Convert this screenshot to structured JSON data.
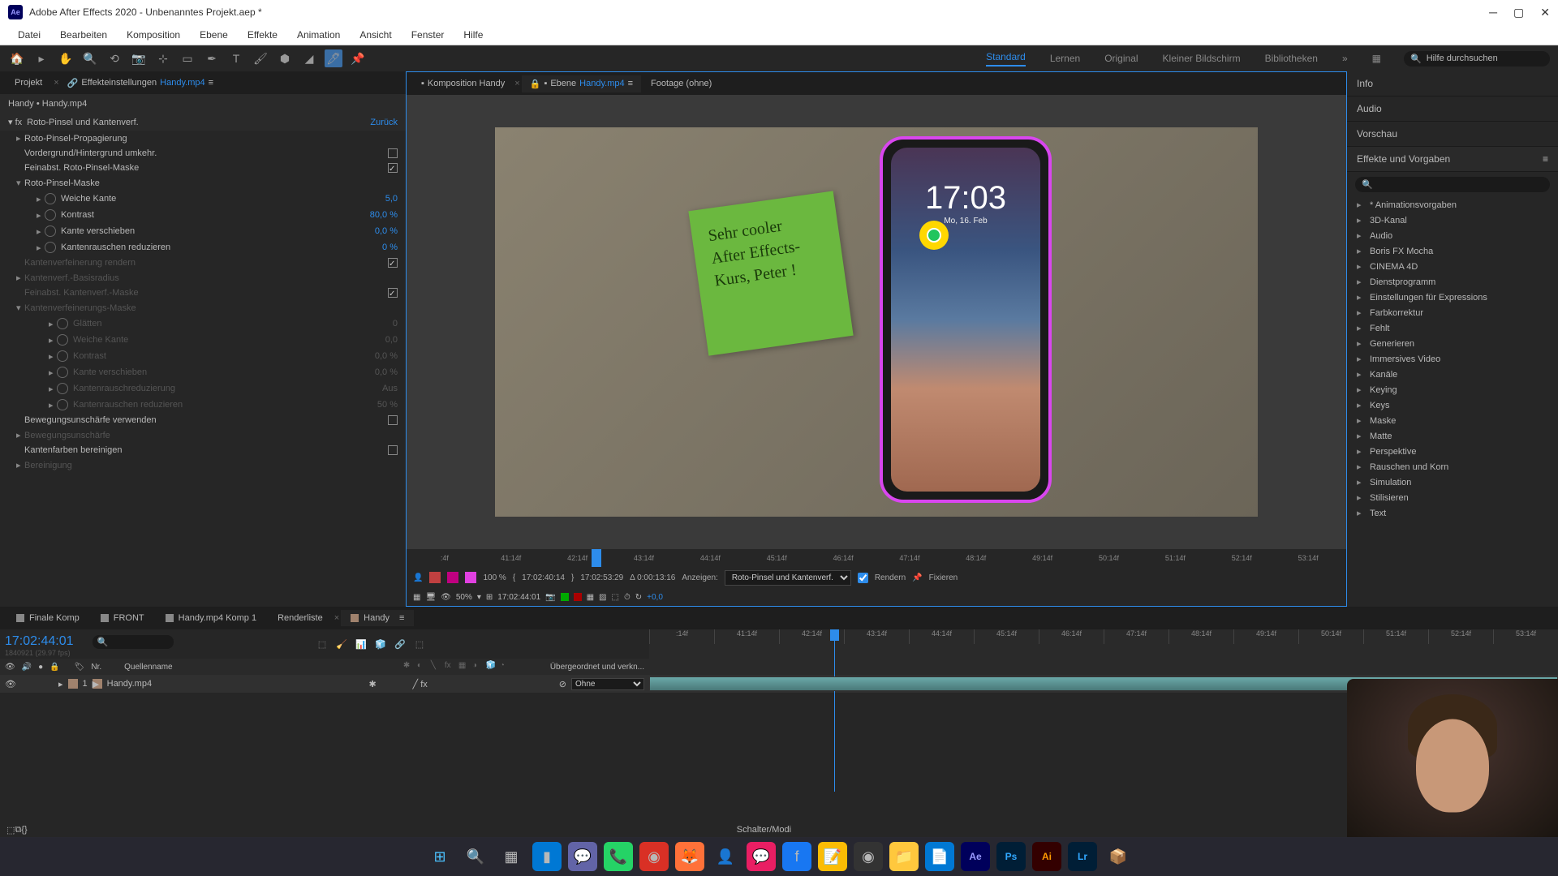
{
  "window": {
    "title": "Adobe After Effects 2020 - Unbenanntes Projekt.aep *",
    "logo": "Ae"
  },
  "menubar": [
    "Datei",
    "Bearbeiten",
    "Komposition",
    "Ebene",
    "Effekte",
    "Animation",
    "Ansicht",
    "Fenster",
    "Hilfe"
  ],
  "workspaces": {
    "items": [
      "Standard",
      "Lernen",
      "Original",
      "Kleiner Bildschirm",
      "Bibliotheken"
    ],
    "active": "Standard",
    "search_placeholder": "Hilfe durchsuchen"
  },
  "left_panel": {
    "tab_project": "Projekt",
    "tab_effects": "Effekteinstellungen",
    "effects_target": "Handy.mp4",
    "breadcrumb": "Handy • Handy.mp4",
    "effect_name": "Roto-Pinsel und Kantenverf.",
    "back_label": "Zurück",
    "props": [
      {
        "type": "group",
        "label": "Roto-Pinsel-Propagierung",
        "twist": "▸"
      },
      {
        "type": "check",
        "label": "Vordergrund/Hintergrund umkehr.",
        "checked": false
      },
      {
        "type": "check",
        "label": "Feinabst. Roto-Pinsel-Maske",
        "checked": true
      },
      {
        "type": "group",
        "label": "Roto-Pinsel-Maske",
        "twist": "▾"
      },
      {
        "type": "prop",
        "label": "Weiche Kante",
        "value": "5,0",
        "indent": "sub"
      },
      {
        "type": "prop",
        "label": "Kontrast",
        "value": "80,0 %",
        "indent": "sub"
      },
      {
        "type": "prop",
        "label": "Kante verschieben",
        "value": "0,0 %",
        "indent": "sub"
      },
      {
        "type": "prop",
        "label": "Kantenrauschen reduzieren",
        "value": "0 %",
        "indent": "sub"
      },
      {
        "type": "check",
        "label": "Kantenverfeinerung rendern",
        "checked": true,
        "dim": true
      },
      {
        "type": "group",
        "label": "Kantenverf.-Basisradius",
        "twist": "▸",
        "dim": true
      },
      {
        "type": "check",
        "label": "Feinabst. Kantenverf.-Maske",
        "checked": true,
        "dim": true
      },
      {
        "type": "group",
        "label": "Kantenverfeinerungs-Maske",
        "twist": "▾",
        "dim": true
      },
      {
        "type": "prop",
        "label": "Glätten",
        "value": "0",
        "indent": "sub2",
        "dim": true
      },
      {
        "type": "prop",
        "label": "Weiche Kante",
        "value": "0,0",
        "indent": "sub2",
        "dim": true
      },
      {
        "type": "prop",
        "label": "Kontrast",
        "value": "0,0 %",
        "indent": "sub2",
        "dim": true
      },
      {
        "type": "prop",
        "label": "Kante verschieben",
        "value": "0,0 %",
        "indent": "sub2",
        "dim": true
      },
      {
        "type": "prop",
        "label": "Kantenrauschreduzierung",
        "value": "Aus",
        "indent": "sub2",
        "dim": true
      },
      {
        "type": "prop",
        "label": "Kantenrauschen reduzieren",
        "value": "50 %",
        "indent": "sub2",
        "dim": true
      },
      {
        "type": "check",
        "label": "Bewegungsunschärfe verwenden",
        "checked": false
      },
      {
        "type": "group",
        "label": "Bewegungsunschärfe",
        "twist": "▸",
        "dim": true
      },
      {
        "type": "check",
        "label": "Kantenfarben bereinigen",
        "checked": false
      },
      {
        "type": "group",
        "label": "Bereinigung",
        "twist": "▸",
        "dim": true
      }
    ]
  },
  "viewer": {
    "tabs": [
      {
        "icon": "■",
        "label": "Komposition Handy"
      },
      {
        "icon": "■",
        "label": "Ebene",
        "link": "Handy.mp4",
        "active": true
      },
      {
        "label": "Footage (ohne)"
      }
    ],
    "note_text": "Sehr cooler\nAfter Effects-\nKurs, Peter !",
    "phone_time": "17:03",
    "phone_date": "Mo, 16. Feb",
    "ruler_ticks": [
      ":4f",
      "41:14f",
      "42:14f",
      "43:14f",
      "44:14f",
      "45:14f",
      "46:14f",
      "47:14f",
      "48:14f",
      "49:14f",
      "50:14f",
      "51:14f",
      "52:14f",
      "53:14f"
    ],
    "controls": {
      "pct": "100 %",
      "tc_in": "17:02:40:14",
      "tc_out": "17:02:53:29",
      "duration": "Δ 0:00:13:16",
      "anzeigen_label": "Anzeigen:",
      "anzeigen_value": "Roto-Pinsel und Kantenverf.",
      "rendern": "Rendern",
      "fixieren": "Fixieren"
    },
    "bottom": {
      "zoom": "50%",
      "tc": "17:02:44:01",
      "offset": "+0,0"
    }
  },
  "right_panel": {
    "sections": [
      "Info",
      "Audio",
      "Vorschau"
    ],
    "active_section": "Effekte und Vorgaben",
    "presets": [
      "* Animationsvorgaben",
      "3D-Kanal",
      "Audio",
      "Boris FX Mocha",
      "CINEMA 4D",
      "Dienstprogramm",
      "Einstellungen für Expressions",
      "Farbkorrektur",
      "Fehlt",
      "Generieren",
      "Immersives Video",
      "Kanäle",
      "Keying",
      "Keys",
      "Maske",
      "Matte",
      "Perspektive",
      "Rauschen und Korn",
      "Simulation",
      "Stilisieren",
      "Text"
    ]
  },
  "timeline": {
    "tabs": [
      {
        "label": "Finale Komp",
        "color": "#888"
      },
      {
        "label": "FRONT",
        "color": "#888"
      },
      {
        "label": "Handy.mp4 Komp 1",
        "color": "#888"
      },
      {
        "label": "Renderliste"
      },
      {
        "label": "Handy",
        "color": "#a0826d",
        "active": true
      }
    ],
    "timecode": "17:02:44:01",
    "subcode": "1840921 (29.97 fps)",
    "ruler_ticks": [
      ":14f",
      "41:14f",
      "42:14f",
      "43:14f",
      "44:14f",
      "45:14f",
      "46:14f",
      "47:14f",
      "48:14f",
      "49:14f",
      "50:14f",
      "51:14f",
      "52:14f",
      "53:14f"
    ],
    "col_nr": "Nr.",
    "col_name": "Quellenname",
    "col_parent": "Übergeordnet und verkn...",
    "layer": {
      "num": "1",
      "name": "Handy.mp4",
      "parent": "Ohne"
    },
    "footer": "Schalter/Modi"
  }
}
